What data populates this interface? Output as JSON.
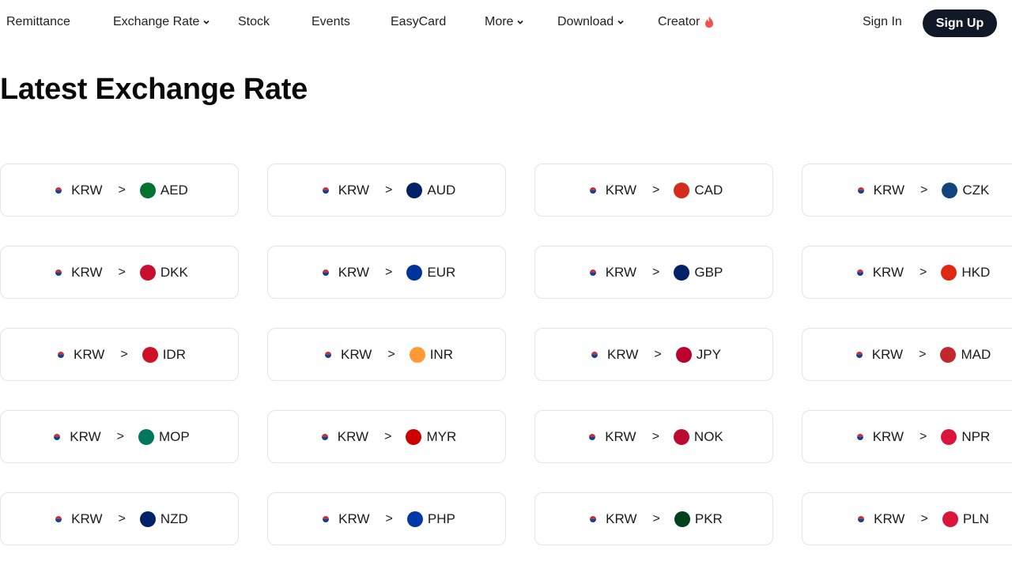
{
  "nav": {
    "remittance": "Remittance",
    "exchange_rate": "Exchange Rate",
    "stock": "Stock",
    "events": "Events",
    "easycard": "EasyCard",
    "more": "More",
    "download": "Download",
    "creator": "Creator",
    "sign_in": "Sign In",
    "sign_up": "Sign Up"
  },
  "page_title": "Latest Exchange Rate",
  "base_currency": "KRW",
  "arrow": ">",
  "pairs": [
    {
      "code": "AED",
      "color": "#00732f"
    },
    {
      "code": "AUD",
      "color": "#012169"
    },
    {
      "code": "CAD",
      "color": "#d52b1e"
    },
    {
      "code": "CZK",
      "color": "#11457e"
    },
    {
      "code": "DKK",
      "color": "#c8102e"
    },
    {
      "code": "EUR",
      "color": "#003399"
    },
    {
      "code": "GBP",
      "color": "#012169"
    },
    {
      "code": "HKD",
      "color": "#de2910"
    },
    {
      "code": "IDR",
      "color": "#ce1126"
    },
    {
      "code": "INR",
      "color": "#ff9933"
    },
    {
      "code": "JPY",
      "color": "#bc002d"
    },
    {
      "code": "MAD",
      "color": "#c1272d"
    },
    {
      "code": "MOP",
      "color": "#00785e"
    },
    {
      "code": "MYR",
      "color": "#cc0001"
    },
    {
      "code": "NOK",
      "color": "#ba0c2f"
    },
    {
      "code": "NPR",
      "color": "#dc143c"
    },
    {
      "code": "NZD",
      "color": "#012169"
    },
    {
      "code": "PHP",
      "color": "#0038a8"
    },
    {
      "code": "PKR",
      "color": "#01411c"
    },
    {
      "code": "PLN",
      "color": "#dc143c"
    }
  ]
}
